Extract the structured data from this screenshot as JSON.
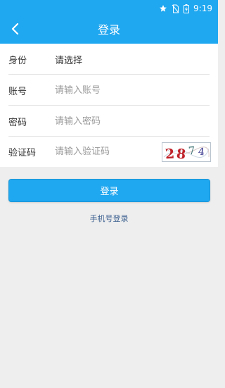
{
  "status_bar": {
    "time": "9:19",
    "icons": [
      "star-icon",
      "no-sim-icon",
      "battery-charging-icon"
    ]
  },
  "app_bar": {
    "title": "登录",
    "back_icon": "chevron-left-icon"
  },
  "form": {
    "identity": {
      "label": "身份",
      "value": "请选择"
    },
    "account": {
      "label": "账号",
      "placeholder": "请输入账号"
    },
    "password": {
      "label": "密码",
      "placeholder": "请输入密码"
    },
    "captcha": {
      "label": "验证码",
      "placeholder": "请输入验证码",
      "code": "2874"
    }
  },
  "login_button": {
    "label": "登录"
  },
  "phone_login_link": {
    "label": "手机号登录"
  },
  "colors": {
    "primary": "#1fa7f0",
    "background": "#eeeeee",
    "link": "#3b5f8f"
  }
}
